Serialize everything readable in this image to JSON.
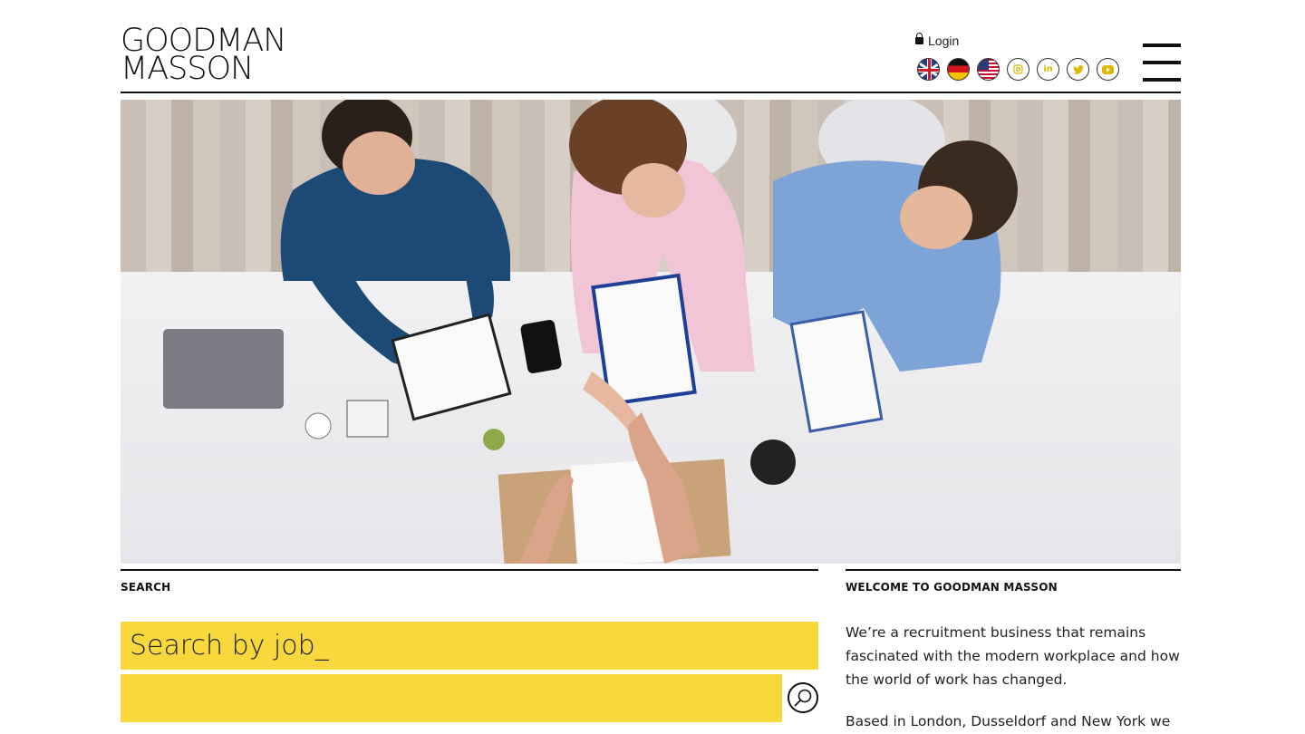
{
  "header": {
    "logo_line1": "GOODMAN",
    "logo_line2": "MASSON",
    "login_label": "Login",
    "flags": [
      "uk-flag-icon",
      "germany-flag-icon",
      "usa-flag-icon"
    ],
    "social": [
      "instagram-icon",
      "linkedin-icon",
      "twitter-icon",
      "youtube-icon"
    ],
    "accent_color": "#f9d83e"
  },
  "hero": {
    "image_subject": "Four people at a white table shaking hands over documents"
  },
  "search": {
    "section_label": "SEARCH",
    "job_placeholder": "Search by job_",
    "location_placeholder": ""
  },
  "welcome": {
    "section_label": "WELCOME TO GOODMAN MASSON",
    "paragraph1": "We’re a recruitment business that remains fascinated with the modern workplace and how the world of work has changed.",
    "paragraph2": "Based in London, Dusseldorf and New York we"
  }
}
